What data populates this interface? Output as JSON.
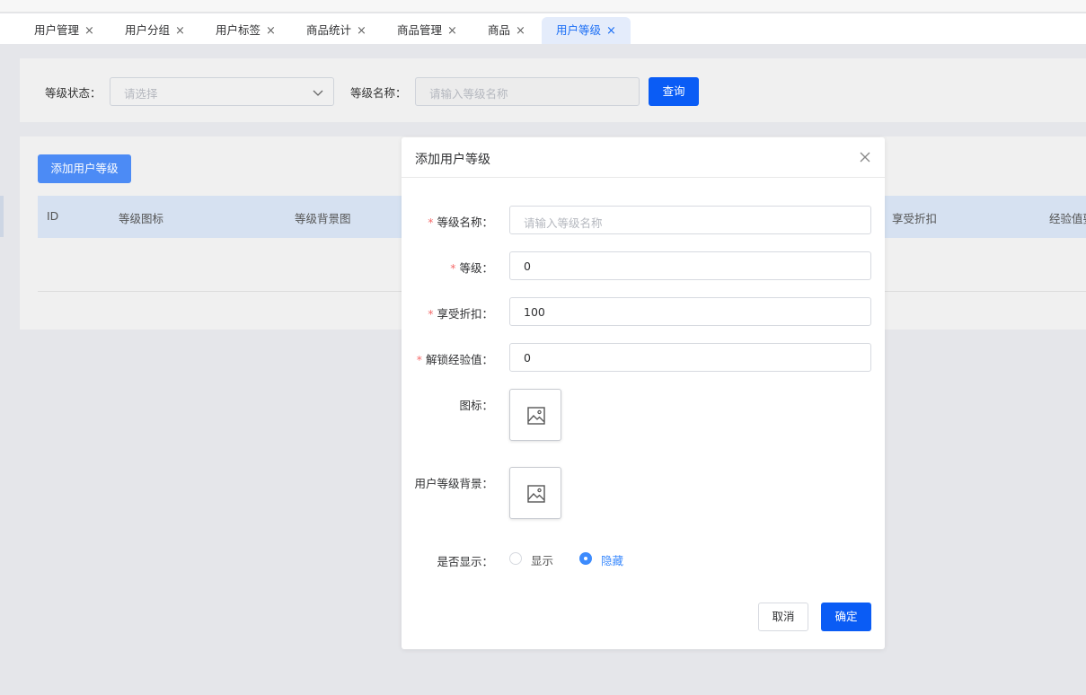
{
  "tabs": [
    {
      "label": "用户管理",
      "active": false
    },
    {
      "label": "用户分组",
      "active": false
    },
    {
      "label": "用户标签",
      "active": false
    },
    {
      "label": "商品统计",
      "active": false
    },
    {
      "label": "商品管理",
      "active": false
    },
    {
      "label": "商品",
      "active": false
    },
    {
      "label": "用户等级",
      "active": true
    }
  ],
  "tab_close_glyph": "×",
  "filter": {
    "status_label": "等级状态：",
    "status_placeholder": "请选择",
    "name_label": "等级名称：",
    "name_placeholder": "请输入等级名称",
    "query_button": "查询"
  },
  "list": {
    "add_button": "添加用户等级",
    "columns": [
      "ID",
      "等级图标",
      "等级背景图",
      "享受折扣",
      "经验值要求"
    ]
  },
  "dialog": {
    "title": "添加用户等级",
    "fields": {
      "name": {
        "label": "等级名称：",
        "required": true,
        "placeholder": "请输入等级名称",
        "value": ""
      },
      "level": {
        "label": "等级：",
        "required": true,
        "value": "0"
      },
      "discount": {
        "label": "享受折扣：",
        "required": true,
        "value": "100"
      },
      "exp": {
        "label": "解锁经验值：",
        "required": true,
        "value": "0"
      },
      "icon": {
        "label": "图标："
      },
      "background": {
        "label": "用户等级背景："
      },
      "visible": {
        "label": "是否显示：",
        "options": [
          "显示",
          "隐藏"
        ],
        "selected": "隐藏"
      }
    },
    "required_mark": "*",
    "cancel_button": "取消",
    "confirm_button": "确定"
  },
  "colors": {
    "primary": "#0a5cf5",
    "add_button": "#4c8bf5",
    "active_tab_bg": "#e4ecfb",
    "required": "#f56c6c",
    "radio_checked": "#3d8bfd"
  },
  "icons": [
    "close-icon",
    "chevron-down-icon",
    "image-upload-icon"
  ]
}
